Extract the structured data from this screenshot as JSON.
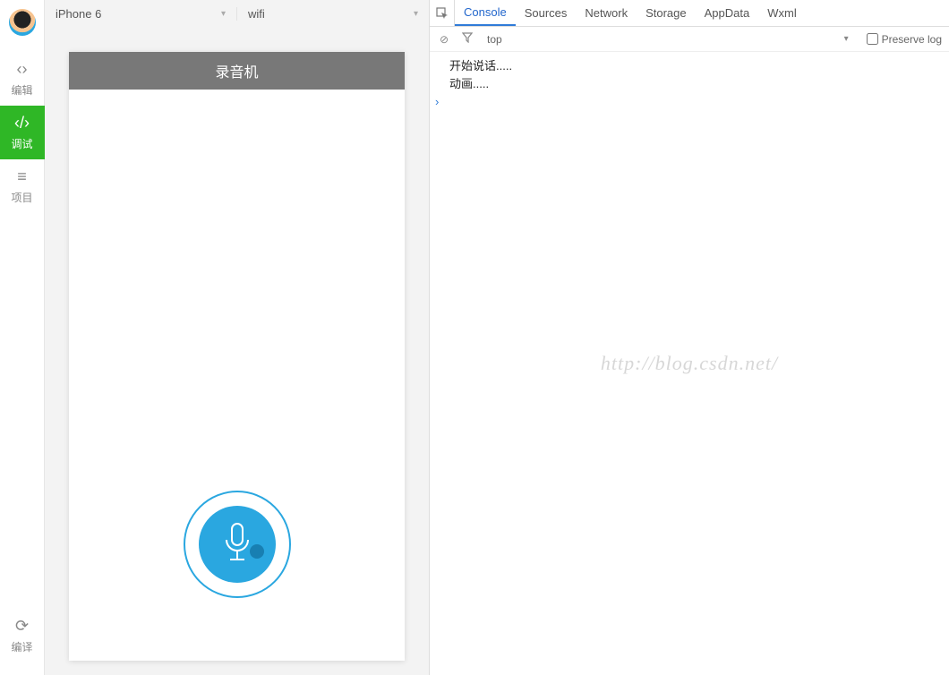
{
  "sidebar": {
    "items": [
      {
        "icon": "‹›",
        "label": "编辑"
      },
      {
        "icon": "‹/›",
        "label": "调试"
      },
      {
        "icon": "≡",
        "label": "项目"
      }
    ],
    "compile": {
      "icon": "⟳",
      "label": "编译"
    }
  },
  "simulator": {
    "device": "iPhone 6",
    "network": "wifi",
    "app_title": "录音机"
  },
  "devtools": {
    "tabs": [
      "Console",
      "Sources",
      "Network",
      "Storage",
      "AppData",
      "Wxml"
    ],
    "active_tab": "Console",
    "context": "top",
    "preserve_log_label": "Preserve log",
    "console_lines": [
      "开始说话.....",
      "动画....."
    ]
  },
  "watermark": "http://blog.csdn.net/"
}
